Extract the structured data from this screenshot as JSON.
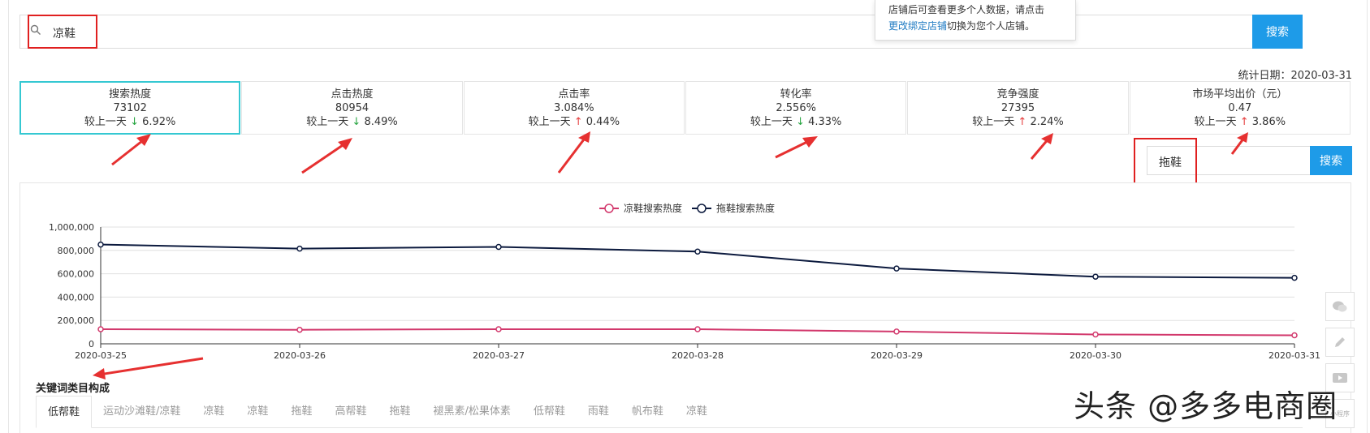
{
  "search": {
    "value": "凉鞋",
    "button": "搜索"
  },
  "tooltip": {
    "line1": "店铺后可查看更多个人数据，请点击",
    "link": "更改绑定店铺",
    "line2_rest": "切换为您个人店铺。"
  },
  "stat_date": "统计日期：2020-03-31",
  "cards": [
    {
      "title": "搜索热度",
      "value": "73102",
      "compare": "较上一天",
      "direction": "down",
      "arrow": "↓",
      "change": "6.92%"
    },
    {
      "title": "点击热度",
      "value": "80954",
      "compare": "较上一天",
      "direction": "down",
      "arrow": "↓",
      "change": "8.49%"
    },
    {
      "title": "点击率",
      "value": "3.084%",
      "compare": "较上一天",
      "direction": "up",
      "arrow": "↑",
      "change": "0.44%"
    },
    {
      "title": "转化率",
      "value": "2.556%",
      "compare": "较上一天",
      "direction": "down",
      "arrow": "↓",
      "change": "4.33%"
    },
    {
      "title": "竞争强度",
      "value": "27395",
      "compare": "较上一天",
      "direction": "up",
      "arrow": "↑",
      "change": "2.24%"
    },
    {
      "title": "市场平均出价（元）",
      "value": "0.47",
      "compare": "较上一天",
      "direction": "up",
      "arrow": "↑",
      "change": "3.86%"
    }
  ],
  "compare_search": {
    "value": "拖鞋",
    "button": "搜索"
  },
  "chart_data": {
    "type": "line",
    "categories": [
      "2020-03-25",
      "2020-03-26",
      "2020-03-27",
      "2020-03-28",
      "2020-03-29",
      "2020-03-30",
      "2020-03-31"
    ],
    "series": [
      {
        "name": "凉鞋搜索热度",
        "color": "#d2386c",
        "values": [
          125000,
          120000,
          125000,
          125000,
          105000,
          80000,
          73102
        ]
      },
      {
        "name": "拖鞋搜索热度",
        "color": "#0c1a3e",
        "values": [
          850000,
          815000,
          830000,
          790000,
          645000,
          575000,
          565000
        ]
      }
    ],
    "yticks": [
      "0",
      "200,000",
      "400,000",
      "600,000",
      "800,000",
      "1,000,000"
    ],
    "ylim": [
      0,
      1000000
    ],
    "legend_position": "top-center",
    "grid": true
  },
  "keyword_section": {
    "title": "关键词类目构成",
    "tabs": [
      "低帮鞋",
      "运动沙滩鞋/凉鞋",
      "凉鞋",
      "凉鞋",
      "拖鞋",
      "高帮鞋",
      "拖鞋",
      "褪黑素/松果体素",
      "低帮鞋",
      "雨鞋",
      "帆布鞋",
      "凉鞋"
    ]
  },
  "side_tools": [
    {
      "icon": "wechat-icon"
    },
    {
      "icon": "edit-icon"
    },
    {
      "icon": "video-icon"
    },
    {
      "icon": "miniprogram-icon",
      "label": "小程序"
    }
  ],
  "watermark": "头条 @多多电商圈"
}
